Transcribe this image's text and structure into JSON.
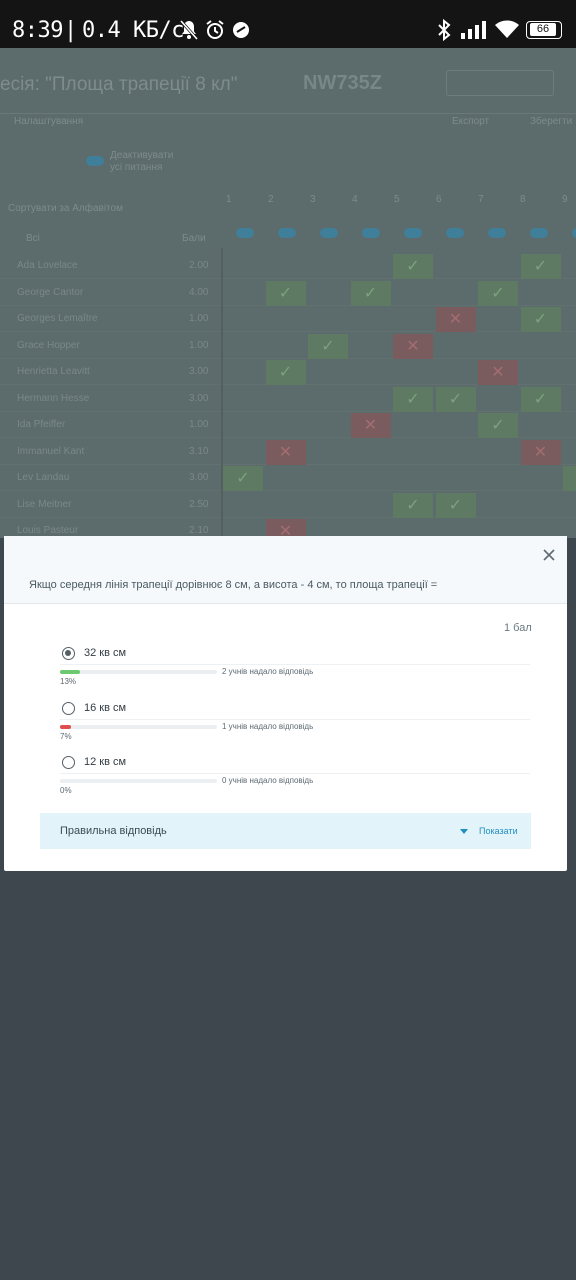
{
  "status_bar": {
    "time": "8:39",
    "separator": "|",
    "speed": "0.4 КБ/с",
    "battery": "66"
  },
  "background": {
    "session_title": "есія: \"Площа трапеції 8 кл\"",
    "session_code": "NW735Z",
    "settings_label": "Налаштування",
    "export_label": "Експорт",
    "save_label": "Зберегти",
    "deactivate_label": "Деактивувати усі питання",
    "students_label": "Сортувати за Алфавітом",
    "all_label": "Всі",
    "score_label": "Бали",
    "question_numbers": [
      "1",
      "2",
      "3",
      "4",
      "5",
      "6",
      "7",
      "8",
      "9"
    ],
    "students": [
      {
        "name": "Ada Lovelace",
        "score": "2.00"
      },
      {
        "name": "George Cantor",
        "score": "4.00"
      },
      {
        "name": "Georges Lemaître",
        "score": "1.00"
      },
      {
        "name": "Grace Hopper",
        "score": "1.00"
      },
      {
        "name": "Henrietta Leavitt",
        "score": "3.00"
      },
      {
        "name": "Hermann Hesse",
        "score": "3.00"
      },
      {
        "name": "Ida Pfeiffer",
        "score": "1.00"
      },
      {
        "name": "Immanuel Kant",
        "score": "3.10"
      },
      {
        "name": "Lev Landau",
        "score": "3.00"
      },
      {
        "name": "Lise Meitner",
        "score": "2.50"
      },
      {
        "name": "Louis Pasteur",
        "score": "2.10"
      }
    ]
  },
  "dialog": {
    "question": "Якщо середня лінія трапеції дорівнює 8 см, а висота - 4 см, то площа трапеції =",
    "points": "1 бал",
    "options": [
      {
        "label": "32 кв см",
        "count_text": "2 учнів надало відповідь",
        "percent": 13,
        "percent_text": "13%",
        "selected": true,
        "color": "#6cc96f"
      },
      {
        "label": "16 кв см",
        "count_text": "1 учнів надало відповідь",
        "percent": 7,
        "percent_text": "7%",
        "selected": false,
        "color": "#e04e4e"
      },
      {
        "label": "12 кв см",
        "count_text": "0 учнів надало відповідь",
        "percent": 0,
        "percent_text": "0%",
        "selected": false,
        "color": "#6cc96f"
      }
    ],
    "correct_answer_label": "Правильна відповідь",
    "show_label": "Показати"
  },
  "icons": {
    "close": "close-icon",
    "caret": "caret-down-icon",
    "bluetooth": "bluetooth-icon",
    "signal": "signal-icon",
    "wifi": "wifi-icon",
    "battery": "battery-icon",
    "mute": "mute-icon",
    "alarm": "alarm-icon"
  },
  "colors": {
    "accent": "#1f8fc0",
    "correct_bar": "#6cc96f",
    "wrong_bar": "#e04e4e",
    "overlay": "#3e474d"
  }
}
